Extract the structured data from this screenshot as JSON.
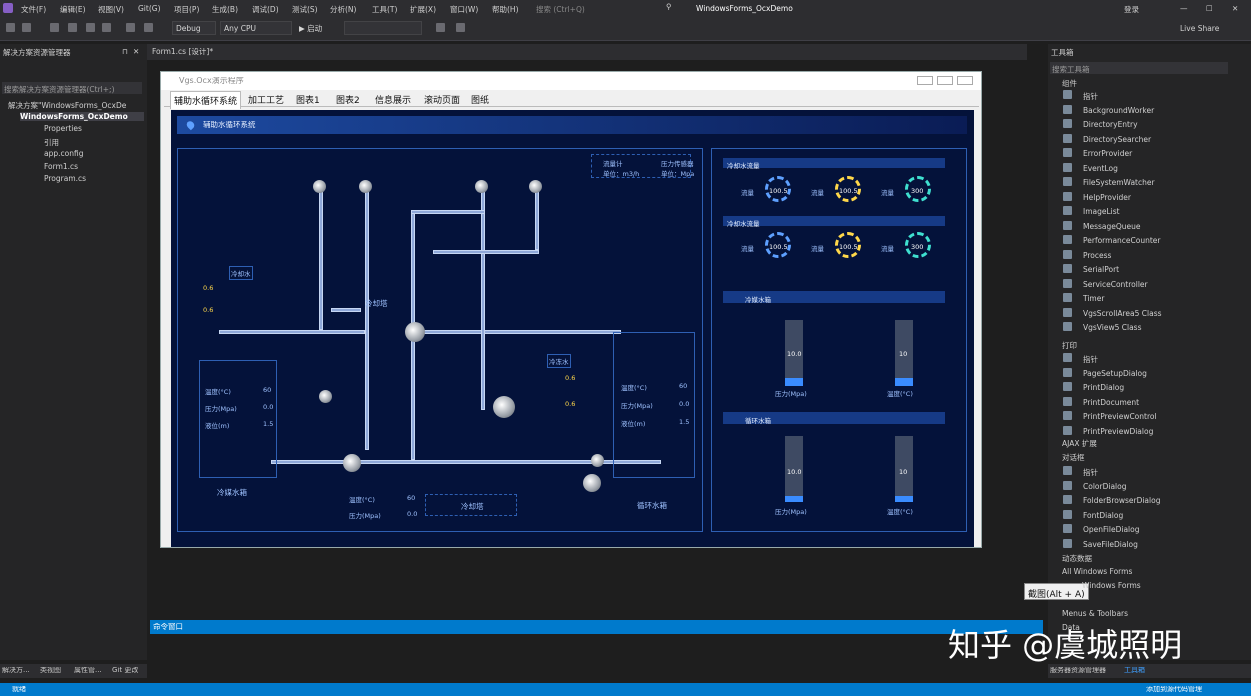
{
  "menubar": {
    "items": [
      "文件(F)",
      "编辑(E)",
      "视图(V)",
      "Git(G)",
      "项目(P)",
      "生成(B)",
      "调试(D)",
      "测试(S)",
      "分析(N)",
      "工具(T)",
      "扩展(X)",
      "窗口(W)",
      "帮助(H)"
    ],
    "search": "搜索 (Ctrl+Q)",
    "project": "WindowsForms_OcxDemo",
    "login": "登录",
    "liveshare": "Live Share"
  },
  "toolbar": {
    "config": "Debug",
    "platform": "Any CPU",
    "start": "启动"
  },
  "solution": {
    "title": "解决方案资源管理器",
    "search": "搜索解决方案资源管理器(Ctrl+;)",
    "root": "解决方案\"WindowsForms_OcxDe",
    "project": "WindowsForms_OcxDemo",
    "items": [
      "Properties",
      "引用",
      "app.config",
      "Form1.cs",
      "Program.cs"
    ]
  },
  "doc": {
    "tab": "Form1.cs [设计]*"
  },
  "form": {
    "title": "Vgs.Ocx演示程序",
    "tabs": [
      "辅助水循环系统",
      "加工工艺",
      "图表1",
      "图表2",
      "信息展示",
      "滚动页面",
      "图纸"
    ]
  },
  "dash": {
    "header": "辅助水循环系统",
    "legend": [
      "流量计",
      "压力传感器",
      "单位：m3/h",
      "单位：Mpa"
    ],
    "labels": {
      "coolwater": "冷却水",
      "coolcooler": "冷却塔",
      "coolbox": "冷媒水箱",
      "circbox": "循环水箱",
      "cooltower2": "冷却塔",
      "pipeTag1": "冷冻水",
      "pipeTag2": "冷却水"
    },
    "readings": [
      "0.6",
      "0.6",
      "0.6",
      "0.6"
    ],
    "boxRows": [
      [
        "温度(°C)",
        "60"
      ],
      [
        "压力(Mpa)",
        "0.0"
      ],
      [
        "液位(m)",
        "1.5"
      ]
    ],
    "bottomRows": [
      [
        "温度(°C)",
        "60"
      ],
      [
        "压力(Mpa)",
        "0.0"
      ]
    ],
    "circRows": [
      [
        "温度(°C)",
        "60"
      ],
      [
        "压力(Mpa)",
        "0.0"
      ],
      [
        "液位(m)",
        "1.5"
      ]
    ],
    "right": {
      "sec1": "冷却水流量",
      "sec2": "冷却水流量",
      "sec3": "冷媒水箱",
      "sec4": "循环水箱",
      "g1": [
        "流量",
        "流量",
        "流量"
      ],
      "gv1": [
        "100.5",
        "100.5",
        "300"
      ],
      "g2": [
        "流量",
        "流量",
        "流量"
      ],
      "gv2": [
        "100.5",
        "100.5",
        "300"
      ],
      "bars": [
        "10.0",
        "10",
        "10.0",
        "10"
      ],
      "barlbl": [
        "压力(Mpa)",
        "温度(°C)",
        "压力(Mpa)",
        "温度(°C)"
      ]
    }
  },
  "toolbox": {
    "title": "工具箱",
    "search": "搜索工具箱",
    "groups": {
      "comp": "组件",
      "print": "打印",
      "ajax": "AJAX 扩展",
      "dialogs": "对话框",
      "data": "动态数据",
      "allwf": "All Windows Forms",
      "wf": "Windows Forms",
      "mt": "Menus & Toolbars",
      "dt": "Data"
    },
    "comp": [
      "指针",
      "BackgroundWorker",
      "DirectoryEntry",
      "DirectorySearcher",
      "ErrorProvider",
      "EventLog",
      "FileSystemWatcher",
      "HelpProvider",
      "ImageList",
      "MessageQueue",
      "PerformanceCounter",
      "Process",
      "SerialPort",
      "ServiceController",
      "Timer",
      "VgsScrollArea5 Class",
      "VgsView5 Class"
    ],
    "print": [
      "指针",
      "PageSetupDialog",
      "PrintDialog",
      "PrintDocument",
      "PrintPreviewControl",
      "PrintPreviewDialog"
    ],
    "dialogs": [
      "指针",
      "ColorDialog",
      "FolderBrowserDialog",
      "FontDialog",
      "OpenFileDialog",
      "SaveFileDialog"
    ]
  },
  "bottom": {
    "cmd": "命令窗口",
    "tabs": [
      "解决方...",
      "类视图",
      "属性管...",
      "Git 更改"
    ],
    "tabs2": [
      "服务器资源管理器",
      "工具箱"
    ],
    "status": "就绪",
    "status_right": "添加到源代码管理"
  },
  "tooltip": "截图(Alt + A)",
  "watermark": "知乎 @虞城照明",
  "colors": {
    "accent": "#007acc",
    "dash": "#04123a"
  }
}
